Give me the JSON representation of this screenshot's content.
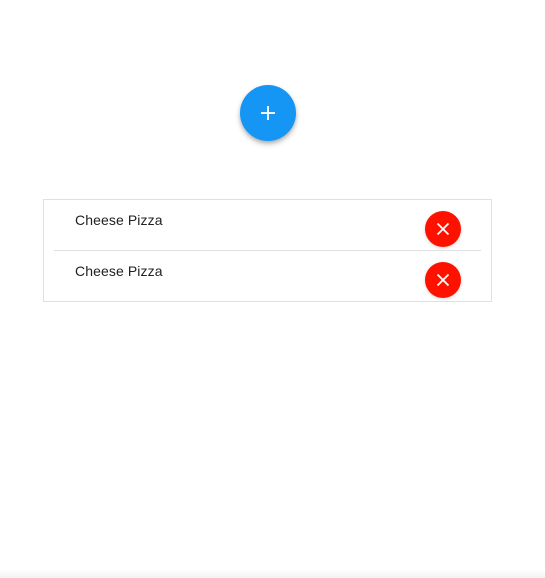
{
  "add_button": {
    "icon": "plus-icon",
    "color": "#1596f5"
  },
  "list": {
    "items": [
      {
        "label": "Cheese Pizza",
        "delete_icon": "close-icon"
      },
      {
        "label": "Cheese Pizza",
        "delete_icon": "close-icon"
      }
    ],
    "delete_color": "#ff1100"
  }
}
